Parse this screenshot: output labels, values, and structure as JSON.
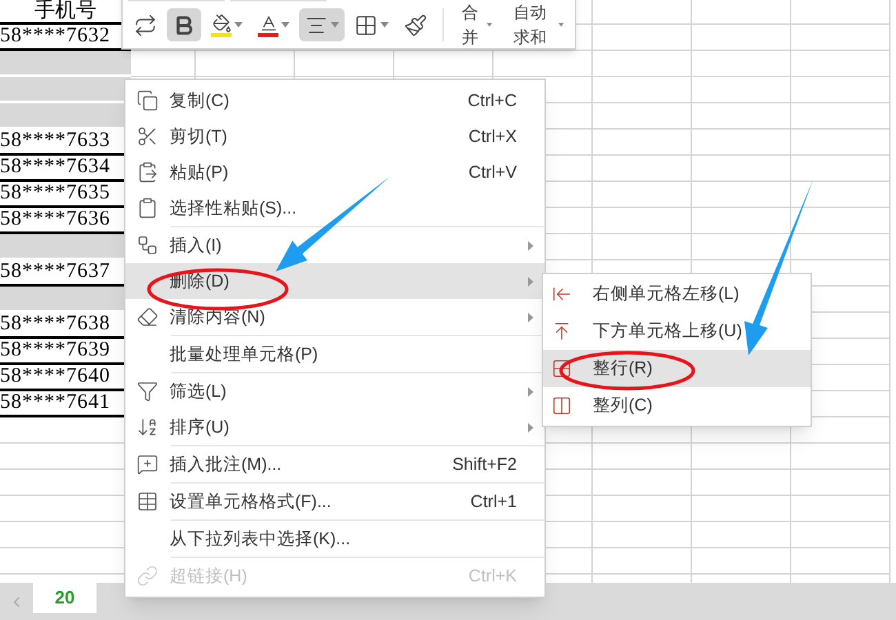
{
  "toolbar": {
    "tools": [
      {
        "selected": false
      },
      {
        "selected": true
      },
      {
        "selected": false,
        "dropdown": true
      },
      {
        "selected": false,
        "dropdown": true
      },
      {
        "selected": true,
        "dropdown": true
      },
      {
        "selected": false,
        "dropdown": true
      },
      {
        "selected": false
      }
    ],
    "dropdowns": [
      {
        "label": "合并"
      },
      {
        "label": "自动求和"
      }
    ]
  },
  "sheet": {
    "header": "手机号",
    "rows": [
      {
        "kind": "phone",
        "text": "58****7632"
      },
      {
        "kind": "blank"
      },
      {
        "kind": "blank"
      },
      {
        "kind": "blank"
      },
      {
        "kind": "phone",
        "text": "58****7633"
      },
      {
        "kind": "phone",
        "text": "58****7634"
      },
      {
        "kind": "phone",
        "text": "58****7635"
      },
      {
        "kind": "phone",
        "text": "58****7636"
      },
      {
        "kind": "blank"
      },
      {
        "kind": "phone",
        "text": "58****7637"
      },
      {
        "kind": "blank"
      },
      {
        "kind": "phone",
        "text": "58****7638"
      },
      {
        "kind": "phone",
        "text": "58****7639"
      },
      {
        "kind": "phone",
        "text": "58****7640"
      },
      {
        "kind": "phone",
        "text": "58****7641"
      }
    ]
  },
  "context_menu": {
    "items": [
      {
        "kind": "item",
        "label": "复制(C)",
        "shortcut": "Ctrl+C",
        "submenu": false,
        "selected": false,
        "disabled": false
      },
      {
        "kind": "item",
        "label": "剪切(T)",
        "shortcut": "Ctrl+X",
        "submenu": false,
        "selected": false,
        "disabled": false
      },
      {
        "kind": "item",
        "label": "粘贴(P)",
        "shortcut": "Ctrl+V",
        "submenu": false,
        "selected": false,
        "disabled": false
      },
      {
        "kind": "item",
        "label": "选择性粘贴(S)...",
        "submenu": false,
        "selected": false,
        "disabled": false
      },
      {
        "kind": "separator"
      },
      {
        "kind": "item",
        "label": "插入(I)",
        "submenu": true,
        "selected": false,
        "disabled": false
      },
      {
        "kind": "item",
        "label": "删除(D)",
        "submenu": true,
        "selected": true,
        "disabled": false
      },
      {
        "kind": "item",
        "label": "清除内容(N)",
        "submenu": true,
        "selected": false,
        "disabled": false
      },
      {
        "kind": "separator"
      },
      {
        "kind": "item",
        "label": "批量处理单元格(P)",
        "submenu": false,
        "selected": false,
        "disabled": false
      },
      {
        "kind": "separator"
      },
      {
        "kind": "item",
        "label": "筛选(L)",
        "submenu": true,
        "selected": false,
        "disabled": false
      },
      {
        "kind": "item",
        "label": "排序(U)",
        "submenu": true,
        "selected": false,
        "disabled": false
      },
      {
        "kind": "separator"
      },
      {
        "kind": "item",
        "label": "插入批注(M)...",
        "shortcut": "Shift+F2",
        "submenu": false,
        "selected": false,
        "disabled": false
      },
      {
        "kind": "separator"
      },
      {
        "kind": "item",
        "label": "设置单元格格式(F)...",
        "shortcut": "Ctrl+1",
        "submenu": false,
        "selected": false,
        "disabled": false
      },
      {
        "kind": "separator"
      },
      {
        "kind": "item",
        "label": "从下拉列表中选择(K)...",
        "submenu": false,
        "selected": false,
        "disabled": false
      },
      {
        "kind": "separator"
      },
      {
        "kind": "item",
        "label": "超链接(H)",
        "shortcut": "Ctrl+K",
        "submenu": false,
        "selected": false,
        "disabled": true
      }
    ]
  },
  "delete_submenu": {
    "items": [
      {
        "label": "右侧单元格左移(L)",
        "selected": false
      },
      {
        "label": "下方单元格上移(U)",
        "selected": false
      },
      {
        "label": "整行(R)",
        "selected": true
      },
      {
        "label": "整列(C)",
        "selected": false
      }
    ]
  },
  "sheet_tabs": [
    {
      "label": "20",
      "selected": true
    }
  ]
}
